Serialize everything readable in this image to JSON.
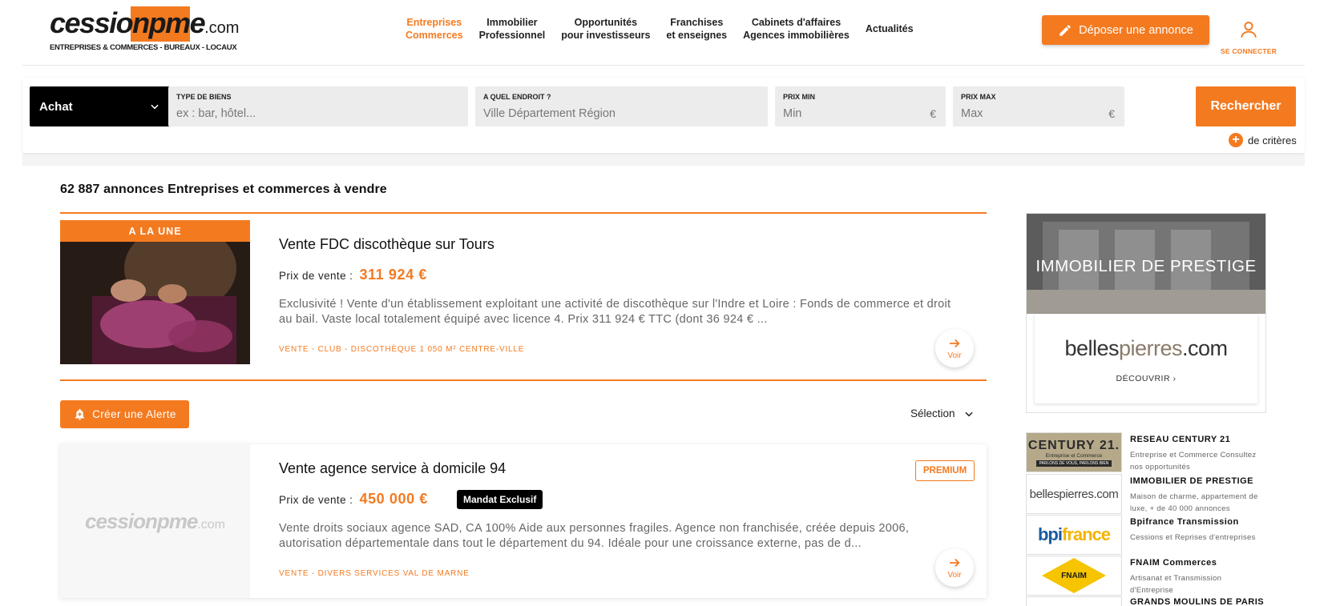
{
  "header": {
    "logo": {
      "part1": "cession",
      "part2": "pme",
      "part3": ".com",
      "tagline": "ENTREPRISES & COMMERCES - BUREAUX - LOCAUX"
    },
    "nav": [
      {
        "line1": "Entreprises",
        "line2": "Commerces",
        "active": true
      },
      {
        "line1": "Immobilier",
        "line2": "Professionnel",
        "active": false
      },
      {
        "line1": "Opportunités",
        "line2": "pour investisseurs",
        "active": false
      },
      {
        "line1": "Franchises",
        "line2": "et enseignes",
        "active": false
      },
      {
        "line1": "Cabinets d'affaires",
        "line2": "Agences immobilières",
        "active": false
      },
      {
        "line1": "Actualités",
        "line2": "",
        "active": false
      }
    ],
    "deposit_label": "Déposer une annonce",
    "login_label": "SE CONNECTER"
  },
  "search": {
    "type_value": "Achat",
    "type_field": {
      "label": "TYPE DE BIENS",
      "placeholder": "ex : bar, hôtel..."
    },
    "where_field": {
      "label": "A QUEL ENDROIT ?",
      "placeholder": "Ville Département Région"
    },
    "min_field": {
      "label": "PRIX MIN",
      "placeholder": "Min",
      "unit": "€"
    },
    "max_field": {
      "label": "PRIX MAX",
      "placeholder": "Max",
      "unit": "€"
    },
    "submit_label": "Rechercher",
    "more_label": "de critères"
  },
  "results": {
    "count_title": "62 887 annonces Entreprises et commerces à vendre"
  },
  "featured": {
    "ribbon": "A LA UNE",
    "title": "Vente FDC discothèque sur Tours",
    "price_label": "Prix de vente :",
    "price": "311 924 €",
    "description": "Exclusivité ! Vente d'un établissement exploitant une activité de discothèque sur l'Indre et Loire : Fonds de commerce et droit au bail. Vaste local totalement équipé avec licence 4. Prix 311 924 € TTC (dont 36 924 € ...",
    "tags": "VENTE - CLUB - DISCOTHÈQUE 1 050 M² CENTRE-VILLE",
    "voir_label": "Voir"
  },
  "toolbar": {
    "alert_label": "Créer une Alerte",
    "sort_label": "Sélection"
  },
  "listing2": {
    "placeholder_logo": {
      "main": "cessionpme",
      "suffix": ".com"
    },
    "title": "Vente agence service à domicile 94",
    "badge": "PREMIUM",
    "price_label": "Prix de vente :",
    "price": "450 000 €",
    "mandat": "Mandat Exclusif",
    "description": "Vente droits sociaux agence SAD, CA 100% Aide aux personnes fragiles. Agence non franchisée, créée depuis 2006, autorisation départementale dans tout le département du 94. Idéale pour une croissance externe, pas de d...",
    "tags": "VENTE - DIVERS SERVICES VAL DE MARNE",
    "voir_label": "Voir"
  },
  "sidebar": {
    "ad": {
      "headline": "IMMOBILIER DE PRESTIGE",
      "brand_a": "belles",
      "brand_b": "pierres",
      "brand_c": ".com",
      "cta": "DÉCOUVRIR ›"
    },
    "partners": [
      {
        "name": "RESEAU CENTURY 21",
        "desc": "Entreprise et Commerce Consultez nos opportunités",
        "logo": {
          "main": "CENTURY 21.",
          "sub": "Entreprise et Commerce",
          "strip": "PARLONS DE VOUS, PARLONS BIEN"
        }
      },
      {
        "name": "IMMOBILIER DE PRESTIGE",
        "desc": "Maison de charme, appartement de luxe, + de 40 000 annonces",
        "logo": {
          "main": "bellespierres.com"
        }
      },
      {
        "name": "Bpifrance Transmission",
        "desc": "Cessions et Reprises d'entreprises",
        "logo": {
          "main_a": "bpi",
          "main_b": "france"
        }
      },
      {
        "name": "FNAIM Commerces",
        "desc": "Artisanat et Transmission d'Entreprise",
        "logo": {
          "main": "FNAIM"
        }
      },
      {
        "name": "GRANDS MOULINS DE PARIS",
        "desc": ""
      }
    ]
  },
  "colors": {
    "accent": "#f47a20",
    "black": "#000000"
  }
}
